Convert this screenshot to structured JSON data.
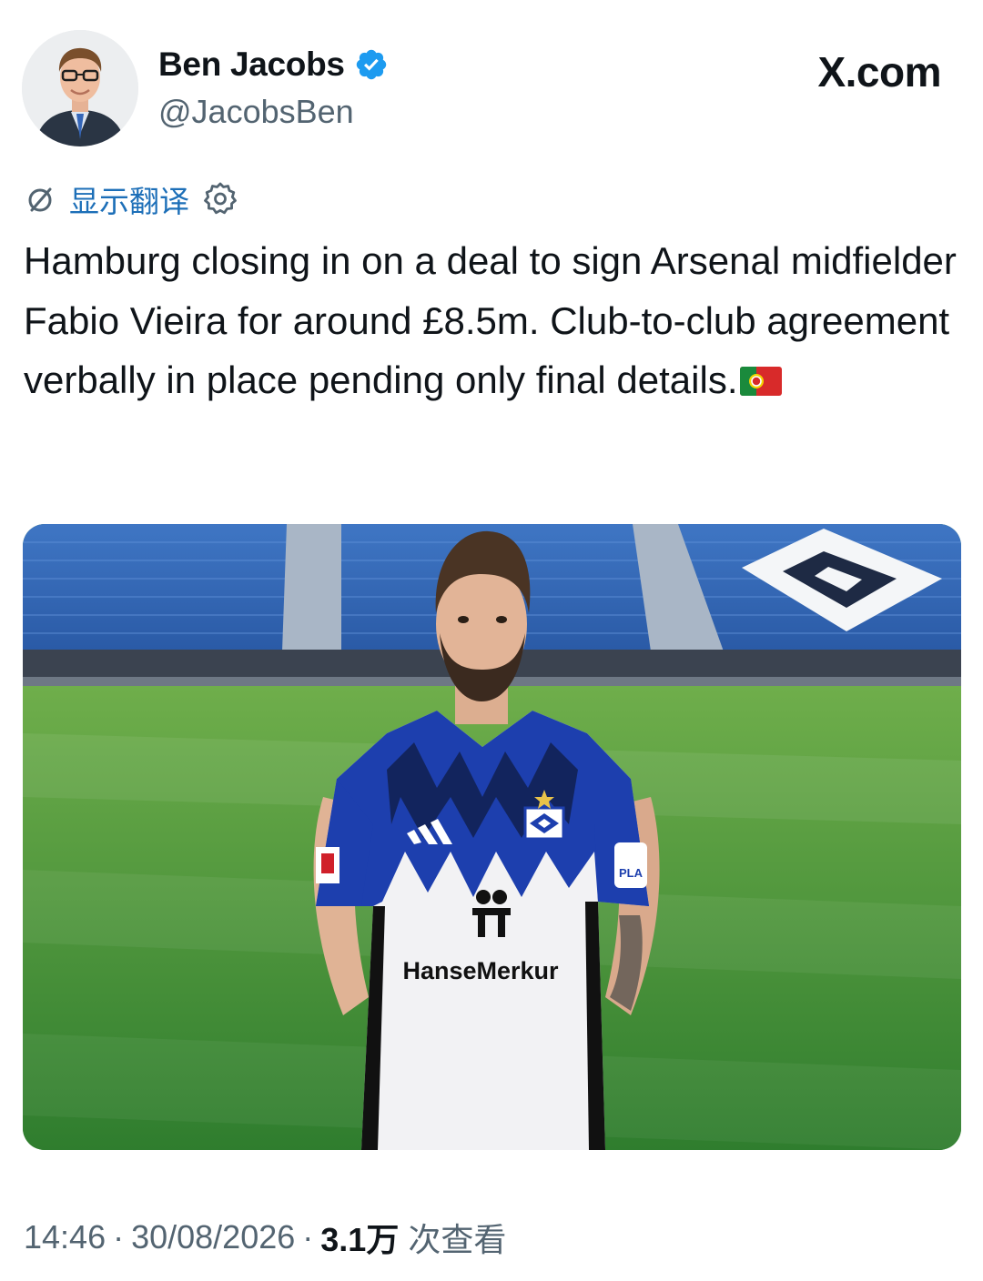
{
  "author": {
    "display_name": "Ben Jacobs",
    "handle": "@JacobsBen",
    "verified": true,
    "verified_color": "#1d9bf0"
  },
  "brand": {
    "label": "X.com"
  },
  "translate": {
    "icon": "translate-icon",
    "label": "显示翻译",
    "settings_icon": "gear-icon",
    "link_color": "#1d6fb8"
  },
  "tweet": {
    "text": "Hamburg closing in on a deal to sign Arsenal midfielder Fabio Vieira for around £8.5m. Club-to-club agreement verbally in place pending only final details.",
    "emoji": "portugal-flag"
  },
  "media": {
    "kind": "photo",
    "jersey_sponsor": "HanseMerkur",
    "sleeve_text": "PLA"
  },
  "meta": {
    "time": "14:46",
    "separator": "·",
    "date": "30/08/2026",
    "views_count": "3.1万",
    "views_label": "次查看"
  }
}
